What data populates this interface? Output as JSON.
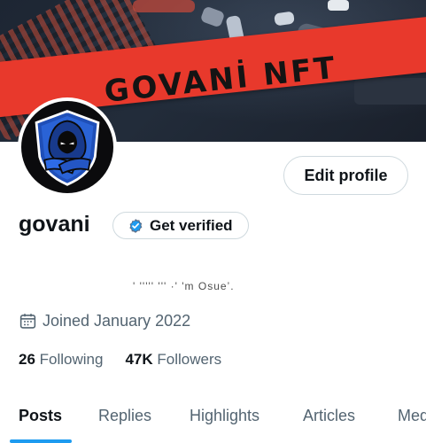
{
  "banner": {
    "text": "GOVANİ NFT",
    "band_color": "#e8392c"
  },
  "avatar": {
    "icon": "hooded-figure-shield-logo"
  },
  "header": {
    "edit_profile_label": "Edit profile"
  },
  "profile": {
    "name": "govani",
    "verify_label": "Get verified",
    "verify_icon": "verified-badge-icon",
    "bio": "'  ''''' ''' ·' 'm Osue’.",
    "joined_icon": "calendar-icon",
    "joined": "Joined January 2022"
  },
  "stats": {
    "following_count": "26",
    "following_label": "Following",
    "followers_count": "47K",
    "followers_label": "Followers"
  },
  "tabs": [
    {
      "label": "Posts",
      "active": true
    },
    {
      "label": "Replies",
      "active": false
    },
    {
      "label": "Highlights",
      "active": false
    },
    {
      "label": "Articles",
      "active": false
    },
    {
      "label": "Media",
      "active": false
    }
  ],
  "colors": {
    "accent": "#1d9bf0",
    "text_primary": "#0f1419",
    "text_secondary": "#536471",
    "border": "#cfd9de"
  }
}
